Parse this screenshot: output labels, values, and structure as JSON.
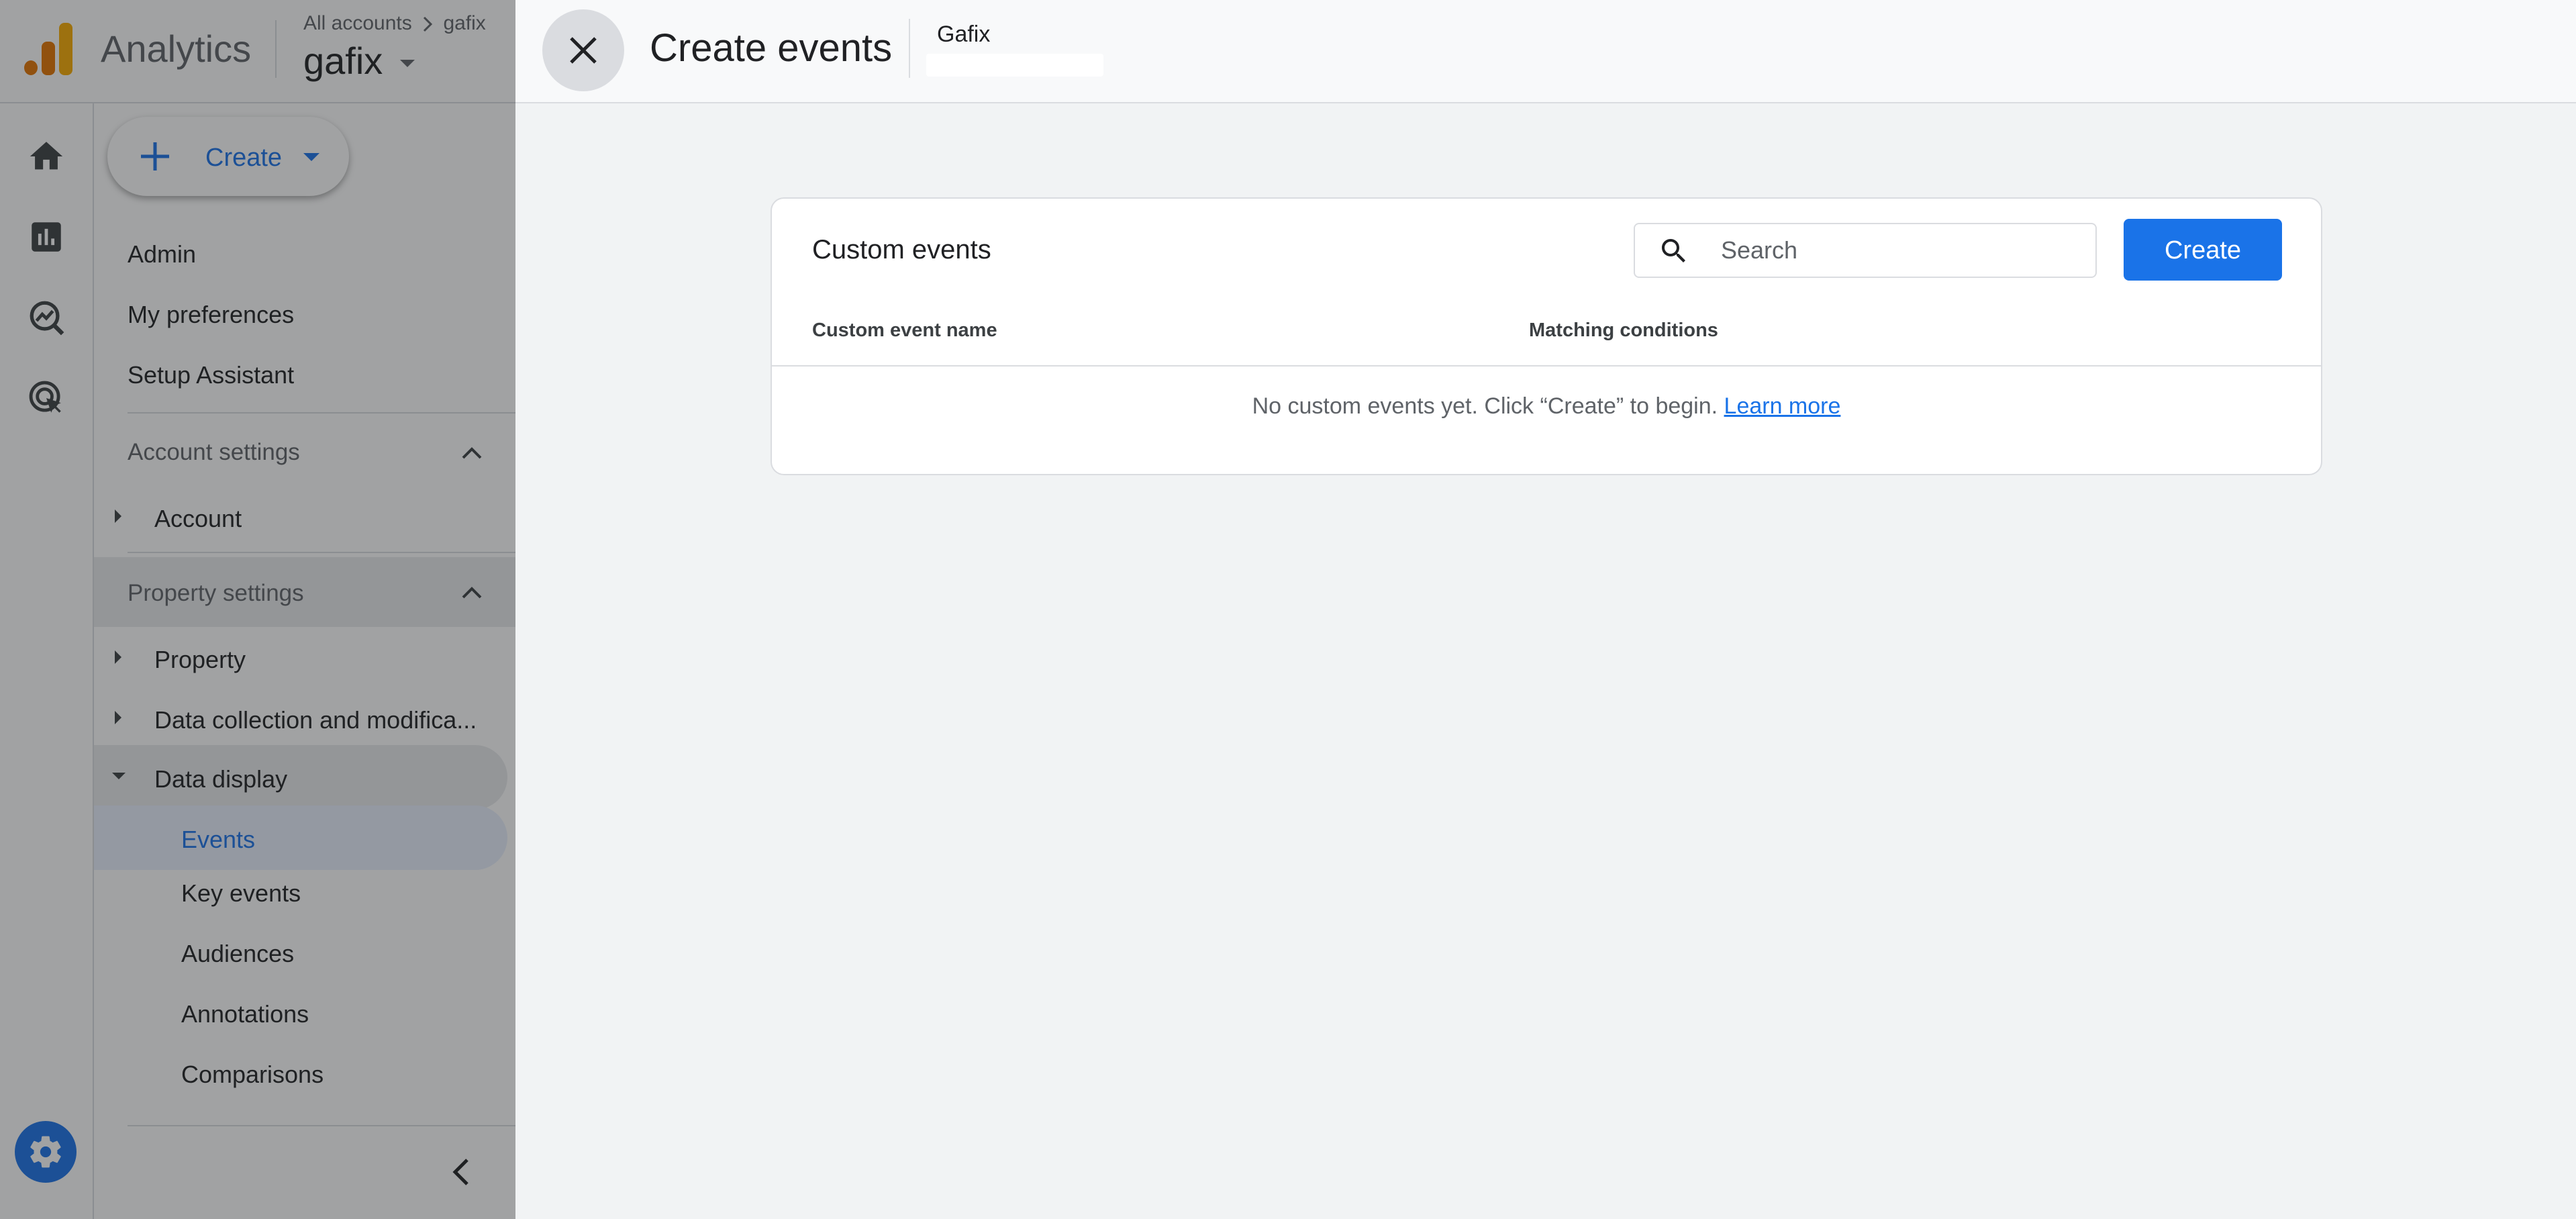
{
  "app": {
    "name": "Analytics",
    "breadcrumb": [
      "All accounts",
      "gafix"
    ],
    "property_name": "gafix"
  },
  "sidebar": {
    "create_label": "Create",
    "top_items": [
      "Admin",
      "My preferences",
      "Setup Assistant"
    ],
    "account_settings": {
      "label": "Account settings",
      "items": [
        "Account"
      ]
    },
    "property_settings": {
      "label": "Property settings",
      "items": [
        "Property",
        "Data collection and modifica...",
        "Data display"
      ]
    },
    "data_display_items": [
      "Events",
      "Key events",
      "Audiences",
      "Annotations",
      "Comparisons"
    ],
    "selected_item": "Events"
  },
  "panel": {
    "title": "Create events",
    "property_label": "Gafix"
  },
  "card": {
    "title": "Custom events",
    "search_placeholder": "Search",
    "create_button": "Create",
    "columns": [
      "Custom event name",
      "Matching conditions"
    ],
    "empty_message": "No custom events yet. Click “Create” to begin.",
    "learn_more": "Learn more"
  },
  "colors": {
    "accent": "#1a73e8",
    "logo_orange": "#f9ab00",
    "logo_dark_orange": "#e37400"
  }
}
